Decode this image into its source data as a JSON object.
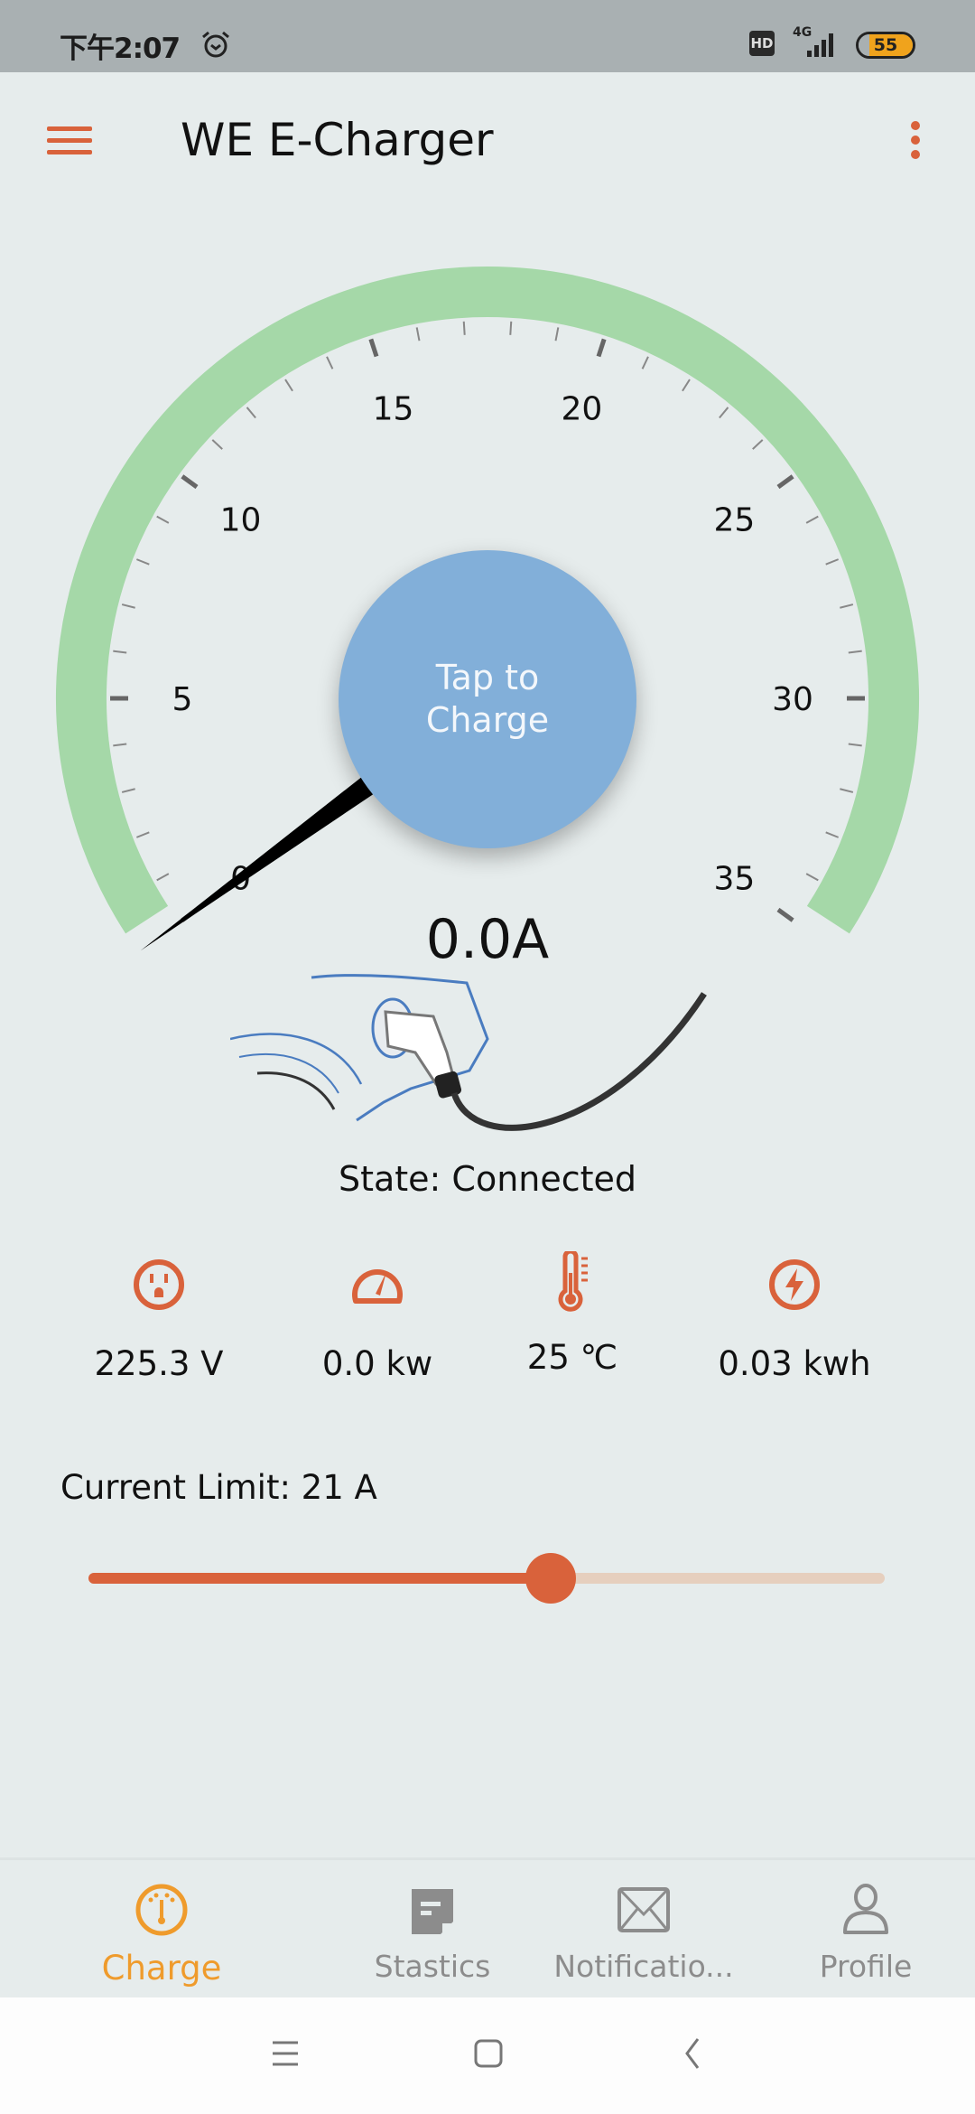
{
  "status_bar": {
    "time": "下午2:07",
    "alarm_icon": "alarm-icon",
    "hd": "HD",
    "network": "4G",
    "battery": "55"
  },
  "app_bar": {
    "title": "WE E-Charger",
    "menu_icon": "hamburger-icon",
    "more_icon": "more-vert-icon"
  },
  "gauge": {
    "min": 0,
    "max": 35,
    "major_step": 5,
    "minor_step": 1,
    "value": 0.0,
    "tick_labels": [
      "0",
      "5",
      "10",
      "15",
      "20",
      "25",
      "30",
      "35"
    ],
    "arc_color": "#a5d8a8",
    "button_label": "Tap to Charge",
    "button_color": "#82afd9"
  },
  "current_reading": "0.0A",
  "state": "State: Connected",
  "metrics": [
    {
      "icon": "outlet-icon",
      "value": "225.3 V"
    },
    {
      "icon": "speedometer-icon",
      "value": "0.0 kw"
    },
    {
      "icon": "thermometer-icon",
      "value": "25 ℃"
    },
    {
      "icon": "lightning-icon",
      "value": "0.03 kwh"
    }
  ],
  "current_limit": {
    "label": "Current Limit: 21 A",
    "value": 21,
    "fraction": 0.58
  },
  "accent_color": "#d9623b",
  "bottom_nav": [
    {
      "label": "Charge",
      "icon": "gauge-icon",
      "active": true
    },
    {
      "label": "Stastics",
      "icon": "note-icon",
      "active": false
    },
    {
      "label": "Notificatio...",
      "icon": "mail-icon",
      "active": false
    },
    {
      "label": "Profile",
      "icon": "person-icon",
      "active": false
    }
  ]
}
